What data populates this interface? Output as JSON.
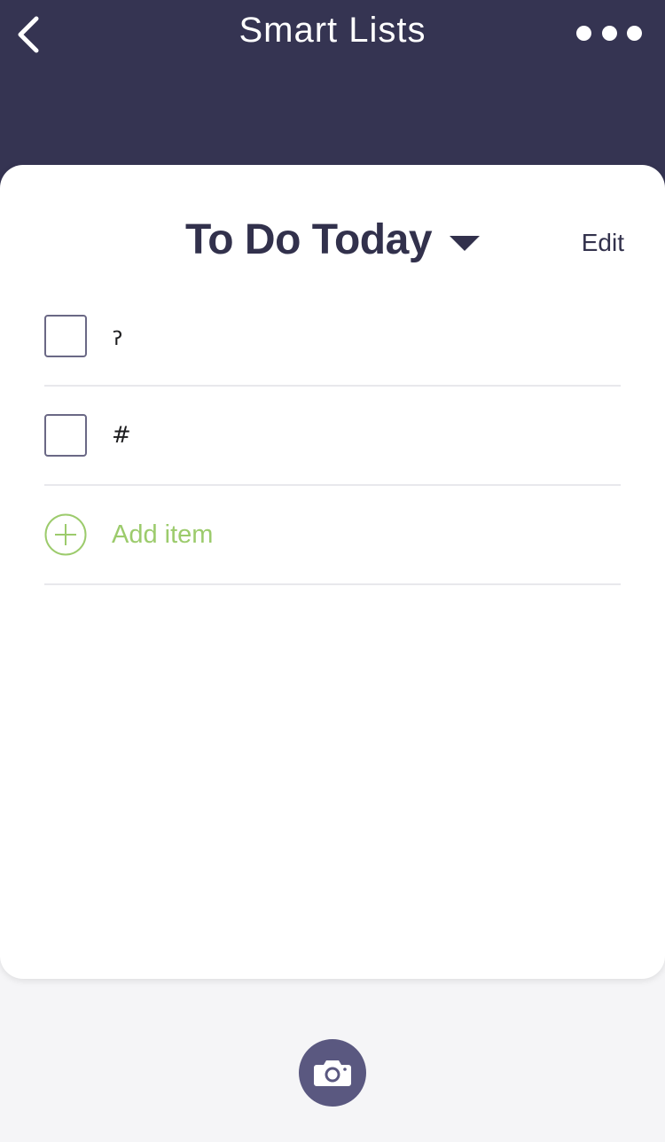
{
  "header": {
    "title": "Smart Lists",
    "back_icon": "chevron-left-icon",
    "more_icon": "more-horizontal-icon",
    "background": "#353452"
  },
  "list": {
    "title": "To Do Today",
    "dropdown_icon": "caret-down-icon",
    "edit_label": "Edit",
    "items": [
      {
        "text": "ॽ",
        "checked": false
      },
      {
        "text": "#",
        "checked": false
      }
    ],
    "add_item_label": "Add item",
    "add_icon": "plus-circle-icon",
    "accent_color": "#9ccb6c"
  },
  "footer": {
    "camera_icon": "camera-icon",
    "button_color": "#5a5880"
  }
}
